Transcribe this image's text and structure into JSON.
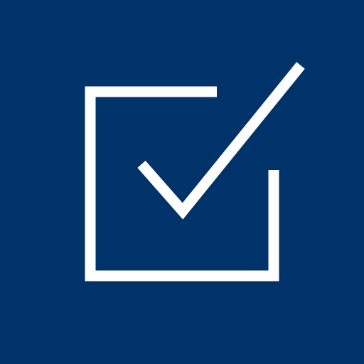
{
  "icon": {
    "name": "checkbox-checked-icon",
    "background_color": "#003369",
    "stroke_color": "#ffffff"
  }
}
